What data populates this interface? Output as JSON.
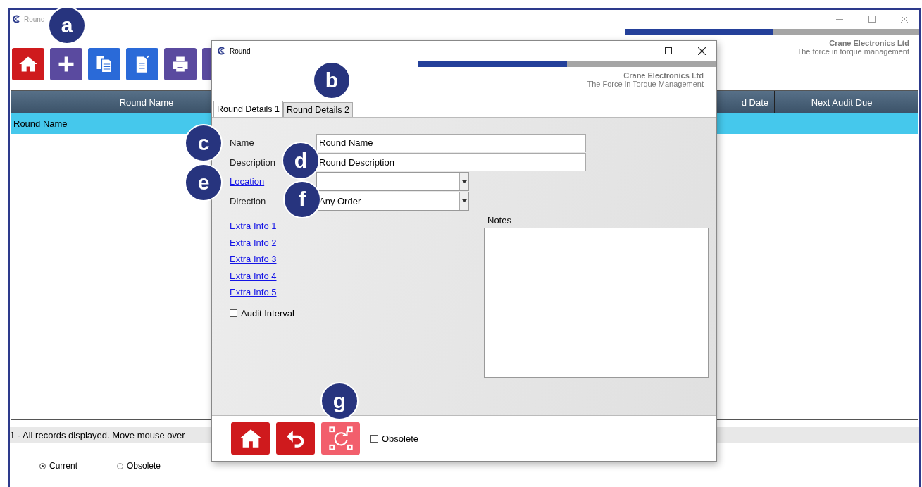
{
  "main_window": {
    "title": "Round",
    "toolbar": [
      {
        "kind": "home"
      },
      {
        "kind": "add"
      },
      {
        "kind": "copy"
      },
      {
        "kind": "edit"
      },
      {
        "kind": "print"
      },
      {
        "kind": "more"
      }
    ],
    "brand": {
      "company": "Crane Electronics Ltd",
      "tagline": "The force in torque management"
    },
    "table": {
      "columns": [
        "Round Name",
        "d Date",
        "Next Audit Due"
      ],
      "rows": [
        {
          "cells": [
            "Round Name",
            "",
            ""
          ],
          "selected": true
        }
      ]
    },
    "status_bar": "1 - All records displayed. Move mouse over",
    "filter": [
      {
        "label": "Current",
        "selected": true
      },
      {
        "label": "Obsolete",
        "selected": false
      }
    ]
  },
  "dialog": {
    "title": "Round",
    "brand": {
      "company": "Crane Electronics Ltd",
      "tagline": "The Force in Torque Management"
    },
    "tabs": [
      {
        "label": "Round Details 1",
        "selected": true
      },
      {
        "label": "Round Details 2",
        "selected": false
      }
    ],
    "fields": [
      {
        "label": "Name",
        "kind": "text",
        "value": "Round Name",
        "link": false
      },
      {
        "label": "Description",
        "kind": "text",
        "value": "Round Description",
        "link": false
      },
      {
        "label": "Location",
        "kind": "combo",
        "link": true
      },
      {
        "label": "Direction",
        "kind": "combo",
        "value": "Any Order",
        "link": false
      }
    ],
    "extra_info": [
      "Extra Info 1",
      "Extra Info 2",
      "Extra Info 3",
      "Extra Info 4",
      "Extra Info 5"
    ],
    "audit_interval": {
      "label": "Audit Interval",
      "checked": false
    },
    "notes": {
      "label": "Notes"
    },
    "footer_buttons": [
      {
        "kind": "home",
        "disabled": false
      },
      {
        "kind": "undo",
        "disabled": false
      },
      {
        "kind": "save",
        "disabled": true
      }
    ],
    "obsolete": {
      "label": "Obsolete",
      "checked": false
    }
  },
  "callouts": [
    "a",
    "b",
    "c",
    "d",
    "e",
    "f",
    "g"
  ]
}
